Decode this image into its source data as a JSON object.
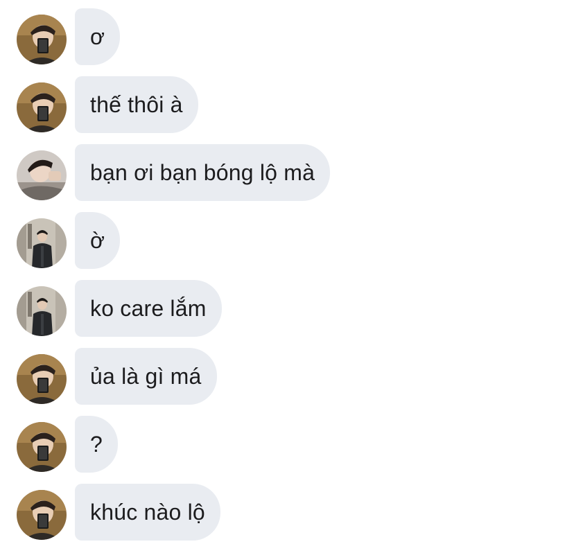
{
  "conversation": {
    "messages": [
      {
        "avatar": "avatar-mirror-selfie",
        "text": "ơ"
      },
      {
        "avatar": "avatar-mirror-selfie",
        "text": "thế thôi à"
      },
      {
        "avatar": "avatar-lying-portrait",
        "text": "bạn ơi bạn bóng lộ mà"
      },
      {
        "avatar": "avatar-standing-jacket",
        "text": "ờ"
      },
      {
        "avatar": "avatar-standing-jacket",
        "text": "ko care lắm"
      },
      {
        "avatar": "avatar-mirror-selfie",
        "text": "ủa là gì má"
      },
      {
        "avatar": "avatar-mirror-selfie",
        "text": "?"
      },
      {
        "avatar": "avatar-mirror-selfie",
        "text": "khúc nào lộ"
      }
    ]
  },
  "colors": {
    "bubble_bg": "#e9ecf1",
    "text": "#1c1c1e",
    "background": "#ffffff"
  }
}
